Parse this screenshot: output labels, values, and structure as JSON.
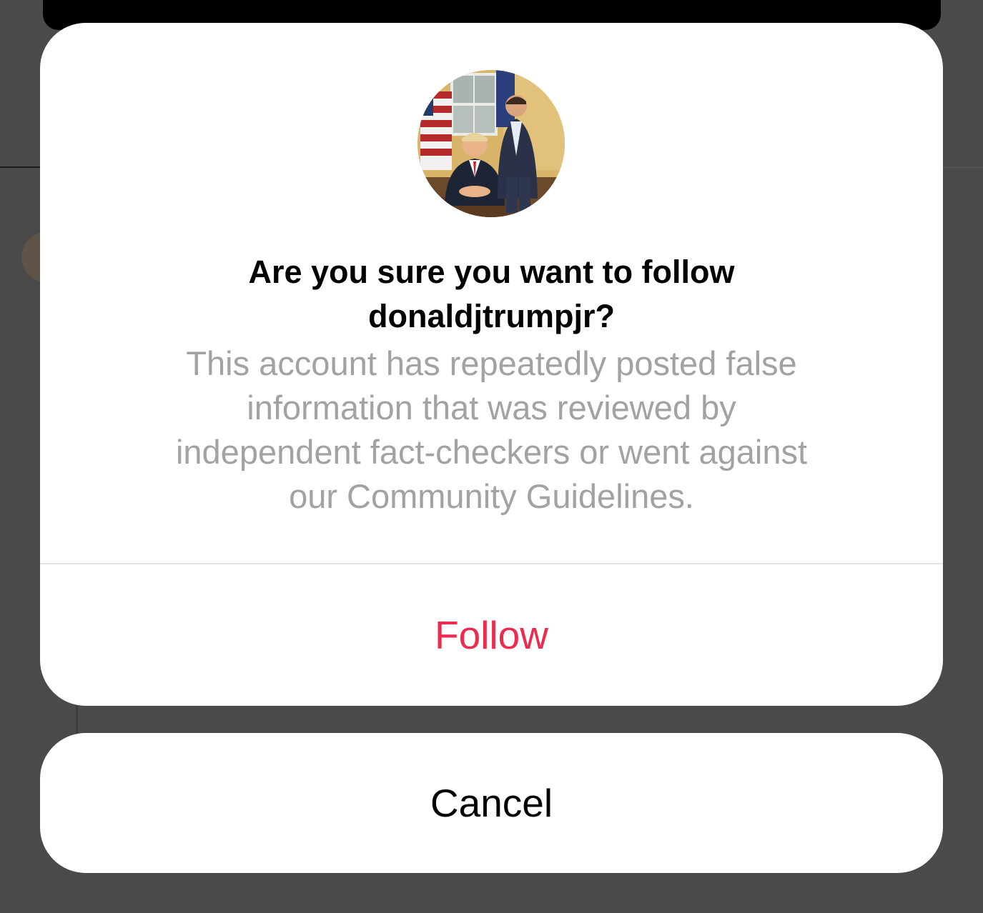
{
  "dialog": {
    "title_line1": "Are you sure you want to follow",
    "title_line2": "donaldjtrumpjr?",
    "message_lines": [
      "This account has repeatedly posted false",
      "information that was reviewed by",
      "independent fact-checkers or went against",
      "our Community Guidelines."
    ],
    "avatar_icon": "profile-photo",
    "follow_label": "Follow",
    "cancel_label": "Cancel"
  },
  "colors": {
    "backdrop": "#4a4a4a",
    "card": "#ffffff",
    "title": "#000000",
    "message": "#a2a2a2",
    "destructive_action": "#ed2b4f",
    "cancel": "#000000",
    "separator": "#e4e4e4"
  }
}
